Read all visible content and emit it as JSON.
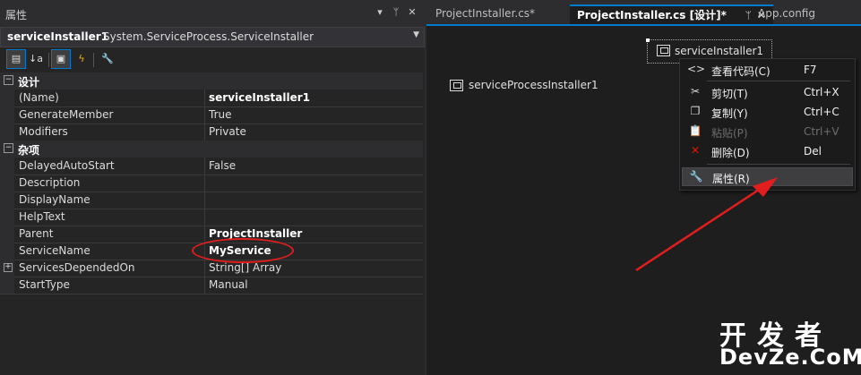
{
  "properties_panel": {
    "title": "属性",
    "title_buttons": [
      "▾",
      "ᛘ",
      "✕"
    ],
    "object_name": "serviceInstaller1",
    "object_type": "System.ServiceProcess.ServiceInstaller",
    "toolbar_icons": [
      "categorized-icon",
      "alphabetical-icon",
      "properties-icon",
      "events-icon",
      "property-pages-icon"
    ],
    "categories": [
      {
        "name": "设计",
        "expander": "⊟",
        "rows": [
          {
            "name": "(Name)",
            "value": "serviceInstaller1",
            "bold": true
          },
          {
            "name": "GenerateMember",
            "value": "True"
          },
          {
            "name": "Modifiers",
            "value": "Private"
          }
        ]
      },
      {
        "name": "杂项",
        "expander": "⊟",
        "rows": [
          {
            "name": "DelayedAutoStart",
            "value": "False"
          },
          {
            "name": "Description",
            "value": ""
          },
          {
            "name": "DisplayName",
            "value": ""
          },
          {
            "name": "HelpText",
            "value": ""
          },
          {
            "name": "Parent",
            "value": "ProjectInstaller",
            "bold": true
          },
          {
            "name": "ServiceName",
            "value": "MyService",
            "bold": true
          },
          {
            "name": "ServicesDependedOn",
            "value": "String[] Array",
            "expander": "⊞"
          },
          {
            "name": "StartType",
            "value": "Manual"
          }
        ]
      }
    ]
  },
  "tabs": [
    {
      "label": "ProjectInstaller.cs*",
      "active": false
    },
    {
      "label": "ProjectInstaller.cs [设计]*",
      "active": true
    },
    {
      "label": "App.config",
      "active": false
    }
  ],
  "tab_pin_icons": [
    "pin-icon",
    "close-icon"
  ],
  "designer": {
    "components": [
      "serviceProcessInstaller1",
      "serviceInstaller1"
    ]
  },
  "context_menu": {
    "items": [
      {
        "icon": "code-icon",
        "glyph": "<>",
        "label": "查看代码(C)",
        "shortcut": "F7",
        "enabled": true
      },
      {
        "icon": "cut-icon",
        "glyph": "✂",
        "label": "剪切(T)",
        "shortcut": "Ctrl+X",
        "enabled": true
      },
      {
        "icon": "copy-icon",
        "glyph": "❐",
        "label": "复制(Y)",
        "shortcut": "Ctrl+C",
        "enabled": true
      },
      {
        "icon": "paste-icon",
        "glyph": "📋",
        "label": "粘贴(P)",
        "shortcut": "Ctrl+V",
        "enabled": false
      },
      {
        "icon": "delete-icon",
        "glyph": "✕",
        "label": "删除(D)",
        "shortcut": "Del",
        "enabled": true
      },
      {
        "icon": "wrench-icon",
        "glyph": "🔧",
        "label": "属性(R)",
        "shortcut": "",
        "enabled": true,
        "highlighted": true
      }
    ]
  },
  "watermark": {
    "line1": "开发者",
    "line2": "DevZe.CoM"
  },
  "colors": {
    "accent": "#007acc",
    "annotation_red": "#e21d1d",
    "panel_bg": "#252526",
    "editor_bg": "#1e1e1e"
  }
}
